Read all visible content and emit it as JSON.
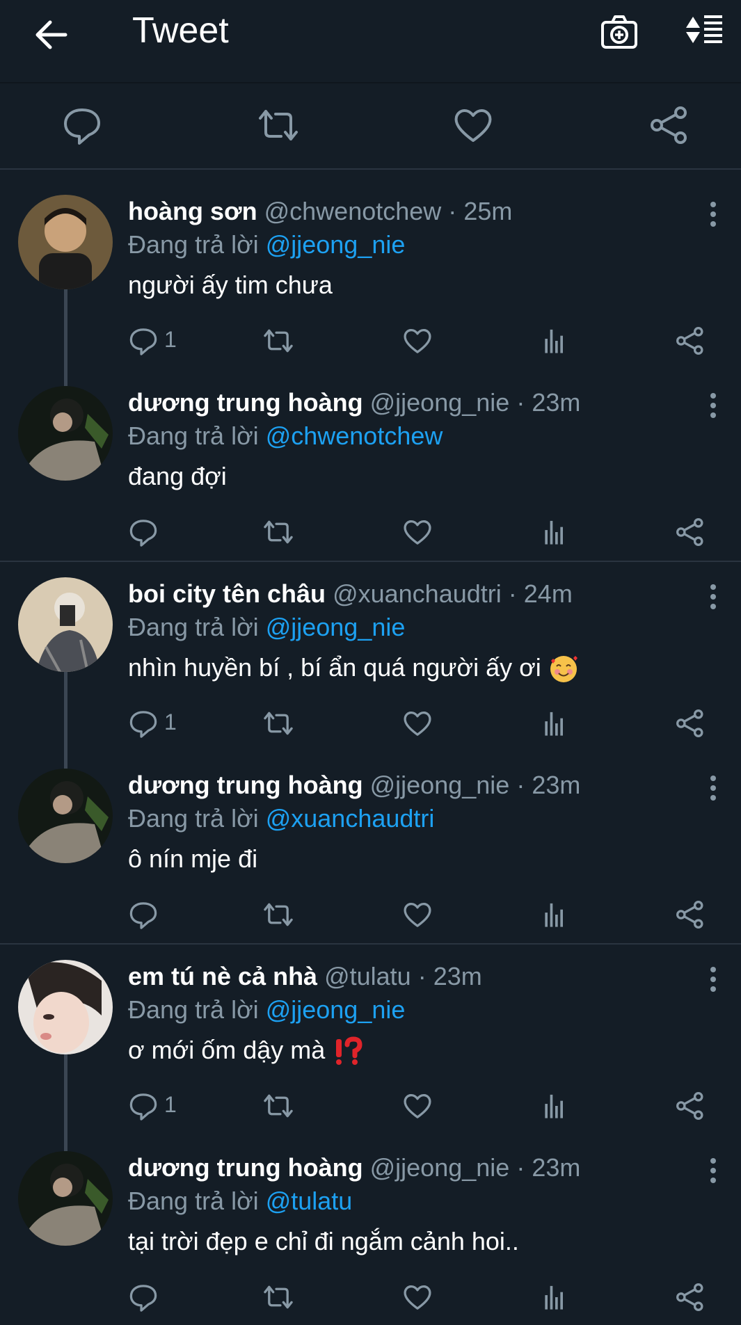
{
  "header": {
    "title": "Tweet"
  },
  "colors": {
    "background": "#141d26",
    "accent": "#1da1f2",
    "muted": "#8899a6"
  },
  "replies": [
    {
      "name": "hoàng sơn",
      "handle": "@chwenotchew",
      "sep": "·",
      "time": "25m",
      "replying_prefix": "Đang trả lời",
      "mention": "@jjeong_nie",
      "text": "người ấy tim chưa",
      "reply_count": "1"
    },
    {
      "name": "dương trung hoàng",
      "handle": "@jjeong_nie",
      "sep": "·",
      "time": "23m",
      "replying_prefix": "Đang trả lời",
      "mention": "@chwenotchew",
      "text": "đang đợi",
      "reply_count": ""
    },
    {
      "name": "boi city tên châu",
      "handle": "@xuanchaudtri",
      "sep": "·",
      "time": "24m",
      "replying_prefix": "Đang trả lời",
      "mention": "@jjeong_nie",
      "text": "nhìn huyền bí , bí ẩn quá người ấy ơi",
      "emoji": "smiling-face-with-hearts",
      "reply_count": "1"
    },
    {
      "name": "dương trung hoàng",
      "handle": "@jjeong_nie",
      "sep": "·",
      "time": "23m",
      "replying_prefix": "Đang trả lời",
      "mention": "@xuanchaudtri",
      "text": "ô nín mje đi",
      "reply_count": ""
    },
    {
      "name": "em tú nè cả nhà",
      "handle": "@tulatu",
      "sep": "·",
      "time": "23m",
      "replying_prefix": "Đang trả lời",
      "mention": "@jjeong_nie",
      "text": "ơ mới ốm dậy mà",
      "emoji": "exclamation-question-mark",
      "reply_count": "1"
    },
    {
      "name": "dương trung hoàng",
      "handle": "@jjeong_nie",
      "sep": "·",
      "time": "23m",
      "replying_prefix": "Đang trả lời",
      "mention": "@tulatu",
      "text": "tại trời đẹp e chỉ đi ngắm cảnh hoi..",
      "reply_count": ""
    }
  ]
}
